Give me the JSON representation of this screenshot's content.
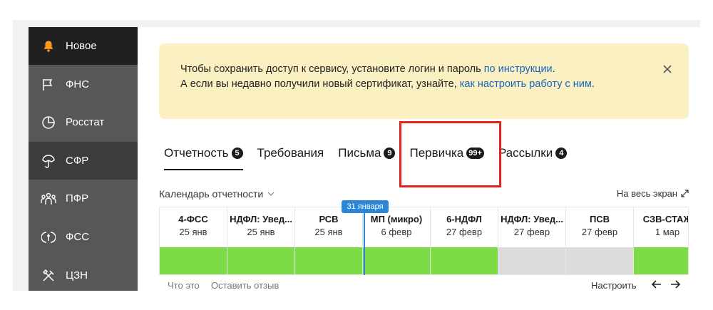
{
  "sidebar": {
    "items": [
      {
        "label": "Новое",
        "icon": "bell-icon"
      },
      {
        "label": "ФНС",
        "icon": "flag-icon"
      },
      {
        "label": "Росстат",
        "icon": "pie-chart-icon"
      },
      {
        "label": "СФР",
        "icon": "umbrella-icon"
      },
      {
        "label": "ПФР",
        "icon": "people-icon"
      },
      {
        "label": "ФСС",
        "icon": "shield-hand-icon"
      },
      {
        "label": "ЦЗН",
        "icon": "tools-icon"
      }
    ]
  },
  "notice": {
    "line1": "Чтобы сохранить доступ к сервису, установите логин и пароль ",
    "line1_link": "по инструкции",
    "line1_end": ".",
    "line2": "А если вы недавно получили новый сертификат, узнайте, ",
    "line2_link": "как настроить работу с ним",
    "line2_end": "."
  },
  "tabs": [
    {
      "label": "Отчетность",
      "count": "5"
    },
    {
      "label": "Требования",
      "count": ""
    },
    {
      "label": "Письма",
      "count": "9"
    },
    {
      "label": "Первичка",
      "count": "99+"
    },
    {
      "label": "Рассылки",
      "count": "4"
    }
  ],
  "calendar": {
    "title": "Календарь отчетности",
    "fullscreen": "На весь экран",
    "marker": "31 января",
    "columns": [
      {
        "name": "4-ФСС",
        "date": "25 янв",
        "status": "done"
      },
      {
        "name": "НДФЛ: Увед...",
        "date": "25 янв",
        "status": "done"
      },
      {
        "name": "РСВ",
        "date": "25 янв",
        "status": "done"
      },
      {
        "name": "МП (микро)",
        "date": "6 февр",
        "status": "done"
      },
      {
        "name": "6-НДФЛ",
        "date": "27 февр",
        "status": "done"
      },
      {
        "name": "НДФЛ: Увед...",
        "date": "27 февр",
        "status": "none"
      },
      {
        "name": "ПСВ",
        "date": "27 февр",
        "status": "none"
      },
      {
        "name": "СЗВ-СТАЖ",
        "date": "1 мар",
        "status": "done"
      }
    ],
    "footer": {
      "what": "Что это",
      "feedback": "Оставить отзыв",
      "setup": "Настроить"
    }
  },
  "colors": {
    "done": "#7ddc45",
    "none": "#dcdcdc",
    "accent": "#2b86d6",
    "highlight": "#e1231e"
  }
}
